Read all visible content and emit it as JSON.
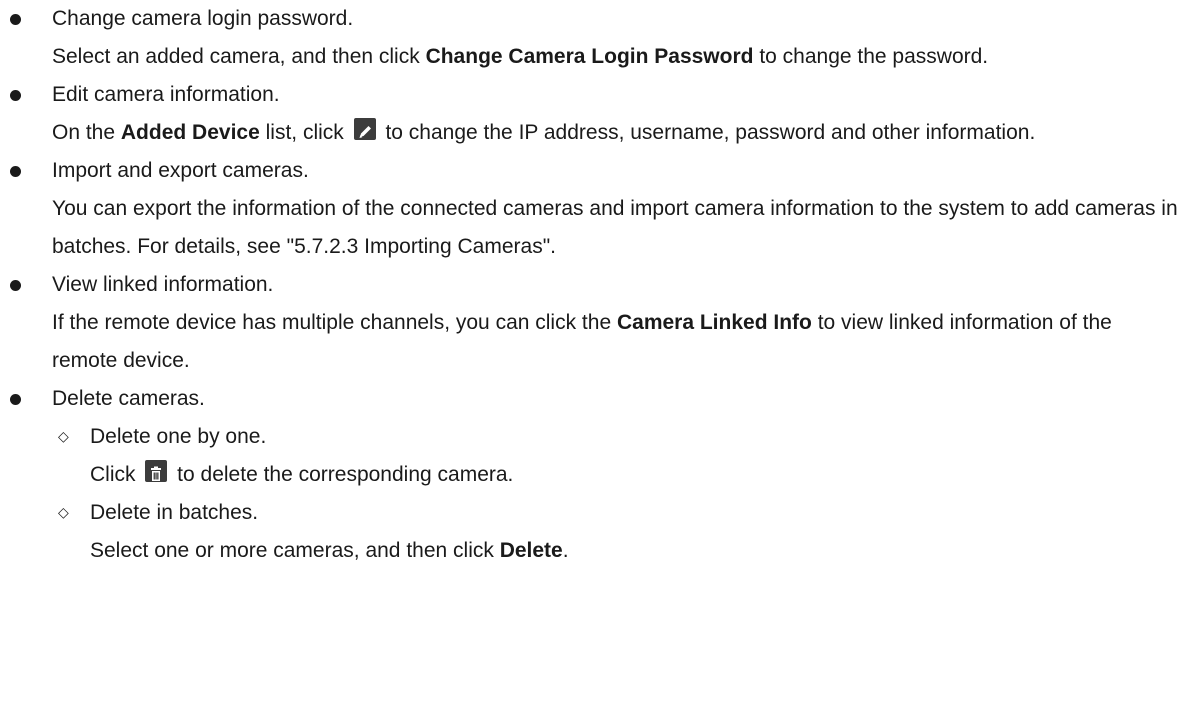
{
  "items": [
    {
      "title": "Change camera login password.",
      "desc_pre": "Select an added camera, and then click ",
      "desc_bold": "Change Camera Login Password",
      "desc_post": " to change the password."
    },
    {
      "title": "Edit camera information.",
      "desc_pre": "On the ",
      "desc_bold": "Added Device",
      "desc_mid": " list, click ",
      "icon": "edit-icon",
      "desc_post": " to change the IP address, username, password and other information."
    },
    {
      "title": "Import and export cameras.",
      "desc": "You can export the information of the connected cameras and import camera information to the system to add cameras in batches. For details, see \"5.7.2.3 Importing Cameras\"."
    },
    {
      "title": "View linked information.",
      "desc_pre": "If the remote device has multiple channels, you can click the ",
      "desc_bold": "Camera Linked Info",
      "desc_post": " to view linked information of the remote device."
    },
    {
      "title": "Delete cameras.",
      "subitems": [
        {
          "title": "Delete one by one.",
          "desc_pre": "Click ",
          "icon": "delete-icon",
          "desc_post": " to delete the corresponding camera."
        },
        {
          "title": "Delete in batches.",
          "desc_pre": "Select one or more cameras, and then click ",
          "desc_bold": "Delete",
          "desc_post": "."
        }
      ]
    }
  ]
}
